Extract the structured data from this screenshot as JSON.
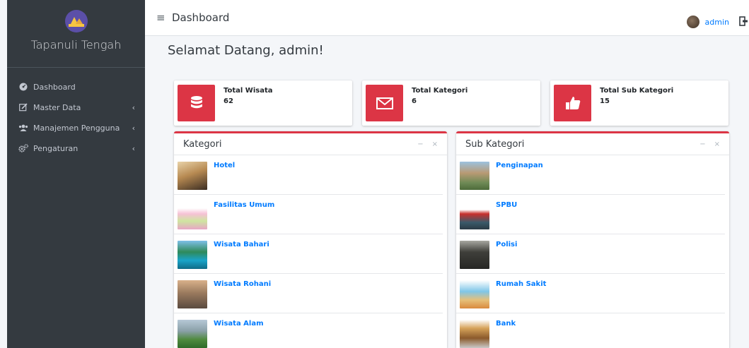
{
  "brand": {
    "name": "Tapanuli Tengah"
  },
  "sidebar": {
    "items": [
      {
        "label": "Dashboard",
        "icon": "dashboard-icon",
        "has_children": false
      },
      {
        "label": "Master Data",
        "icon": "edit-icon",
        "has_children": true
      },
      {
        "label": "Manajemen Pengguna",
        "icon": "users-icon",
        "has_children": true
      },
      {
        "label": "Pengaturan",
        "icon": "cogs-icon",
        "has_children": true
      }
    ],
    "chevron": "‹"
  },
  "header": {
    "menu_glyph": "≡",
    "title": "Dashboard",
    "username": "admin"
  },
  "main": {
    "welcome": "Selamat Datang, admin!",
    "stats": [
      {
        "label": "Total Wisata",
        "value": "62",
        "icon": "database-icon"
      },
      {
        "label": "Total Kategori",
        "value": "6",
        "icon": "envelope-icon"
      },
      {
        "label": "Total Sub Kategori",
        "value": "15",
        "icon": "thumbs-up-icon"
      }
    ],
    "kategori": {
      "title": "Kategori",
      "minimize": "−",
      "close": "×",
      "items": [
        "Hotel",
        "Fasilitas Umum",
        "Wisata Bahari",
        "Wisata Rohani",
        "Wisata Alam"
      ]
    },
    "sub_kategori": {
      "title": "Sub Kategori",
      "minimize": "−",
      "close": "×",
      "items": [
        "Penginapan",
        "SPBU",
        "Polisi",
        "Rumah Sakit",
        "Bank"
      ]
    }
  },
  "colors": {
    "accent": "#dc3545",
    "sidebar": "#343a40",
    "link": "#007bff"
  }
}
